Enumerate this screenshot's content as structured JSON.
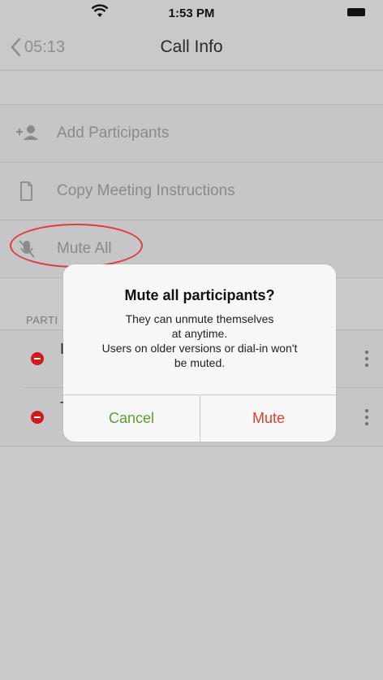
{
  "status_bar": {
    "time": "1:53 PM"
  },
  "nav": {
    "back_label": "05:13",
    "title": "Call Info"
  },
  "actions": [
    {
      "label": "Add Participants",
      "icon": "add-person-icon"
    },
    {
      "label": "Copy Meeting Instructions",
      "icon": "document-icon"
    },
    {
      "label": "Mute All",
      "icon": "microphone-icon"
    }
  ],
  "participants": {
    "header": "PARTI",
    "rows": [
      {
        "name_fragment": "I"
      },
      {
        "name_fragment": "T"
      }
    ]
  },
  "alert": {
    "title": "Mute all participants?",
    "message_lines": [
      "They can unmute themselves",
      "at anytime.",
      "Users on older versions or dial-in won't",
      "be muted."
    ],
    "cancel_label": "Cancel",
    "confirm_label": "Mute"
  },
  "colors": {
    "cancel": "#5aa132",
    "mute": "#e2402f",
    "annotation": "#e23b3b",
    "remove": "#d11a1a"
  }
}
